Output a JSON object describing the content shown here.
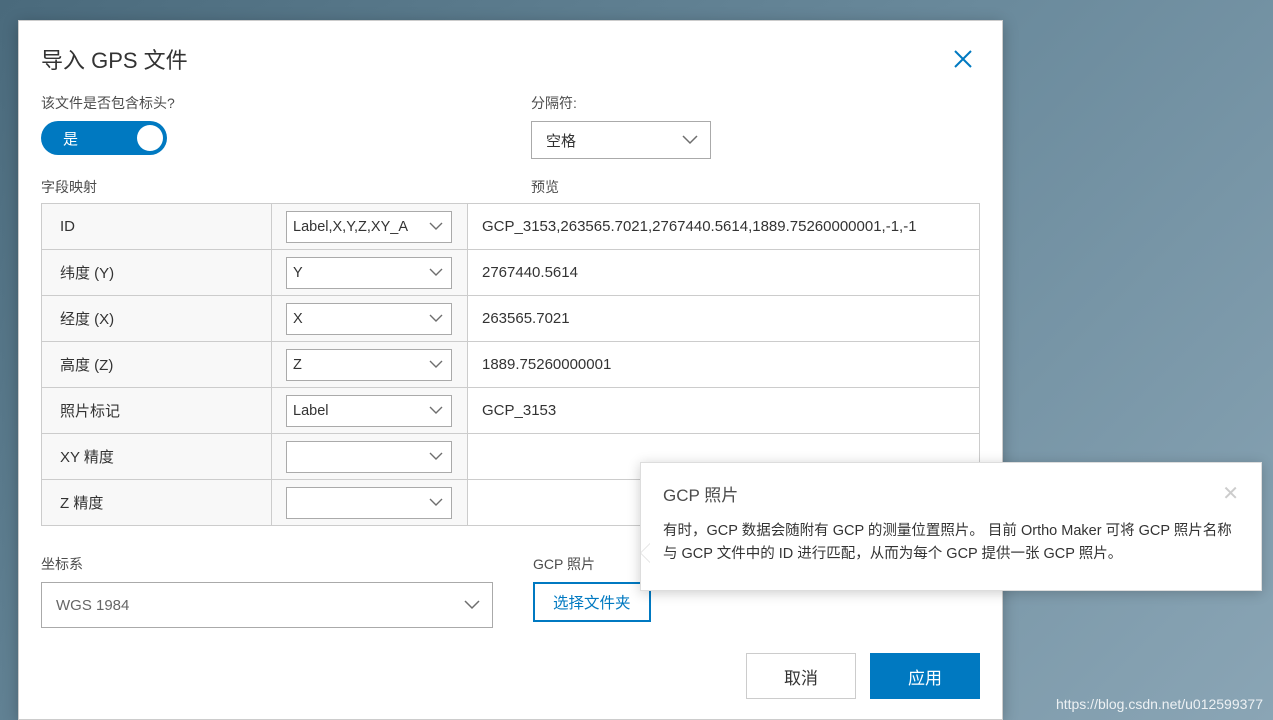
{
  "dialog": {
    "title": "导入 GPS 文件",
    "header_question": "该文件是否包含标头?",
    "toggle_label": "是",
    "delimiter_label": "分隔符:",
    "delimiter_value": "空格",
    "field_mapping_label": "字段映射",
    "preview_label": "预览",
    "rows": [
      {
        "label": "ID",
        "select": "Label,X,Y,Z,XY_A",
        "preview": "GCP_3153,263565.7021,2767440.5614,1889.75260000001,-1,-1"
      },
      {
        "label": "纬度 (Y)",
        "select": "Y",
        "preview": "2767440.5614"
      },
      {
        "label": "经度 (X)",
        "select": "X",
        "preview": "263565.7021"
      },
      {
        "label": "高度 (Z)",
        "select": "Z",
        "preview": "1889.75260000001"
      },
      {
        "label": "照片标记",
        "select": "Label",
        "preview": "GCP_3153"
      },
      {
        "label": "XY 精度",
        "select": "",
        "preview": ""
      },
      {
        "label": "Z 精度",
        "select": "",
        "preview": ""
      }
    ],
    "coord_label": "坐标系",
    "coord_value": "WGS 1984",
    "gcp_label": "GCP 照片",
    "gcp_button": "选择文件夹",
    "cancel": "取消",
    "apply": "应用"
  },
  "tooltip": {
    "title": "GCP 照片",
    "body": "有时，GCP 数据会随附有 GCP 的测量位置照片。 目前 Ortho Maker 可将 GCP 照片名称与 GCP 文件中的 ID 进行匹配，从而为每个 GCP 提供一张 GCP 照片。"
  },
  "watermark": "https://blog.csdn.net/u012599377"
}
